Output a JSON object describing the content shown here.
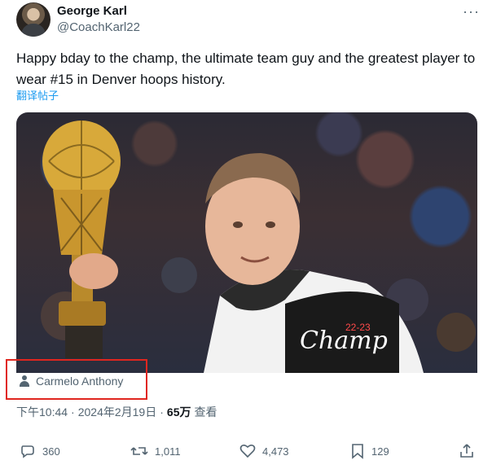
{
  "author": {
    "name": "George Karl",
    "handle": "@CoachKarl22"
  },
  "tweet": {
    "text": "Happy bday to the champ, the ultimate team guy and the greatest player to wear #15 in Denver hoops history.",
    "translate_label": "翻译帖子"
  },
  "media": {
    "tagged_person": "Carmelo Anthony",
    "hat_text": "Champ",
    "hat_year": "22-23"
  },
  "meta": {
    "time": "下午10:44",
    "separator1": "·",
    "date": "2024年2月19日",
    "separator2": "·",
    "views_count": "65万",
    "views_label": "查看"
  },
  "actions": {
    "replies": "360",
    "reposts": "1,011",
    "likes": "4,473",
    "bookmarks": "129"
  },
  "colors": {
    "accent": "#1d9bf0",
    "highlight_box": "#e0261f",
    "muted": "#536471"
  }
}
